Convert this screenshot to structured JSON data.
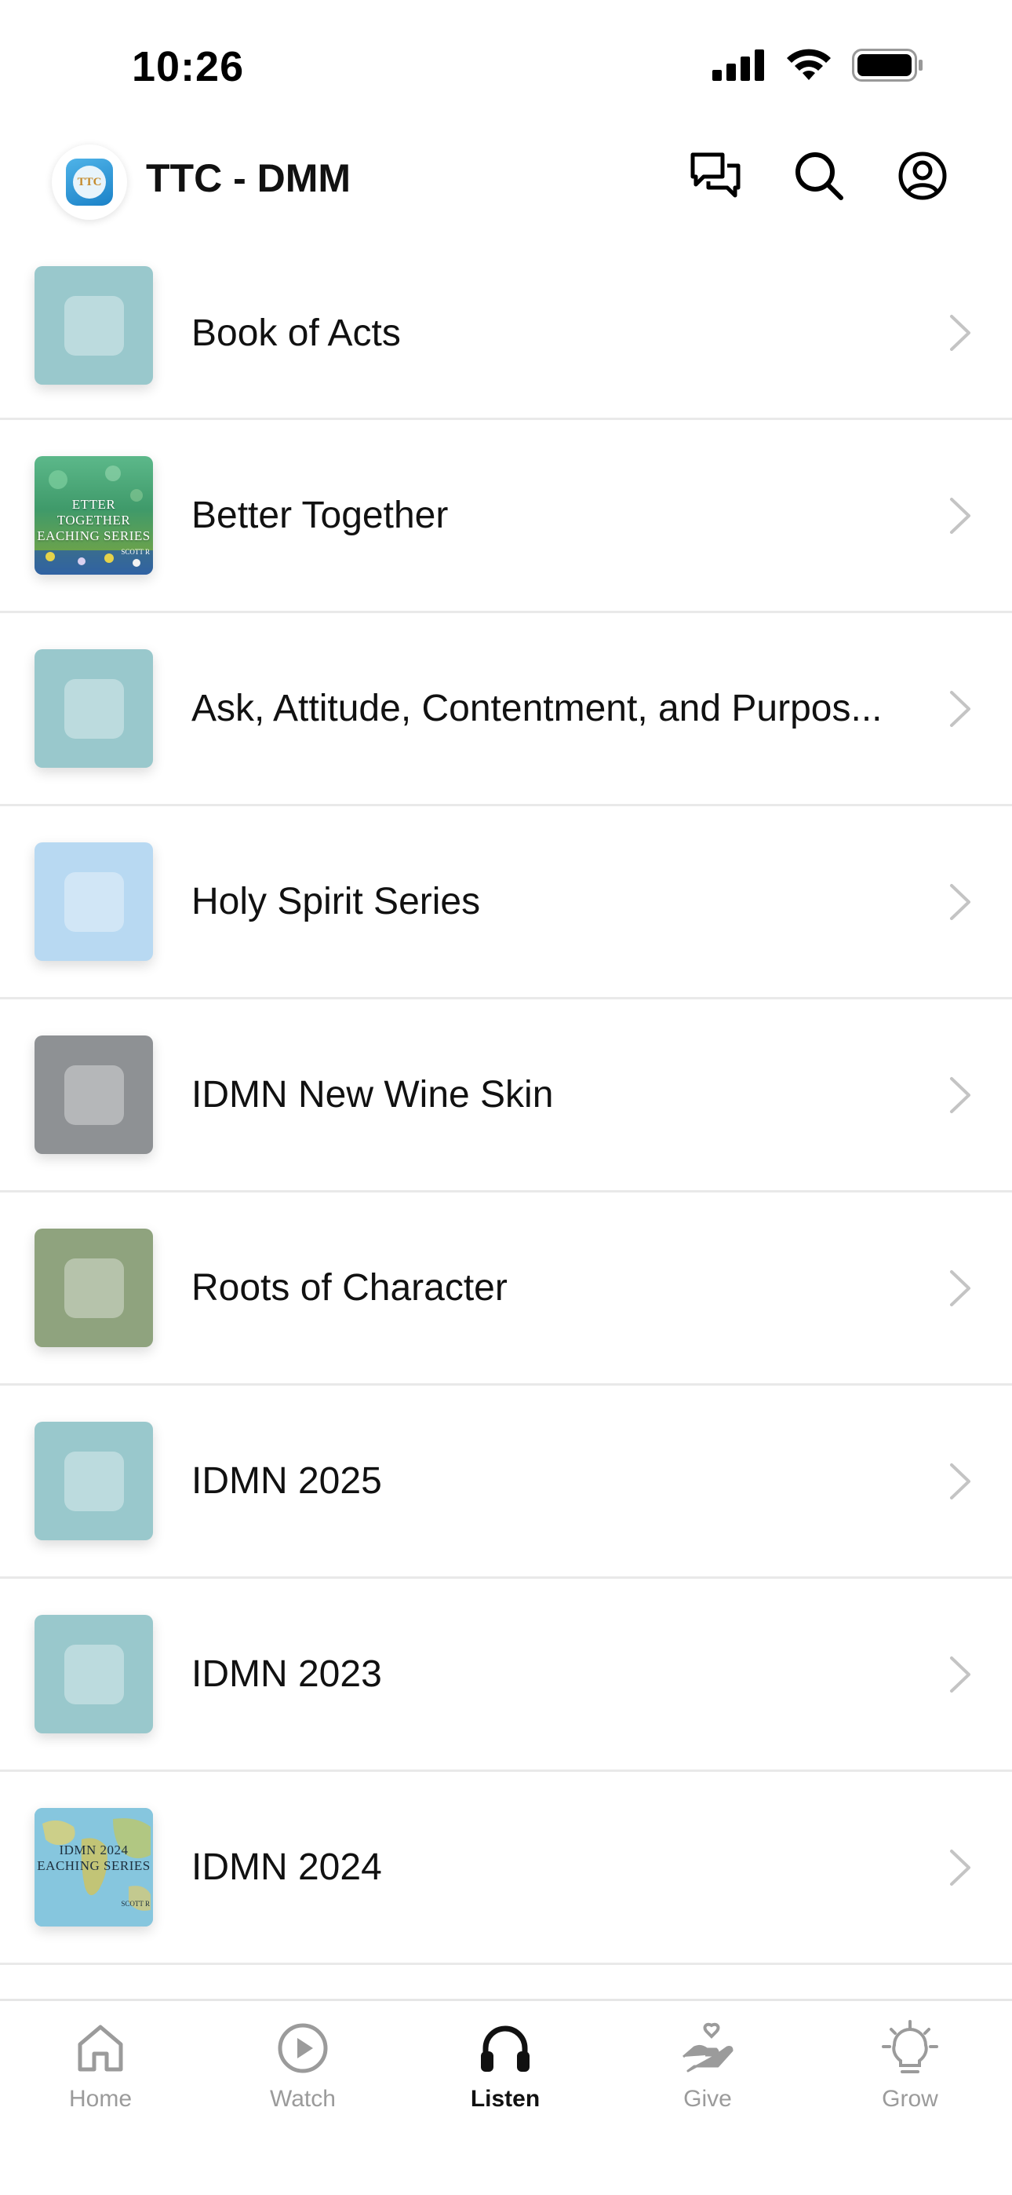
{
  "status_bar": {
    "time": "10:26"
  },
  "header": {
    "logo_text": "TTC",
    "title": "TTC - DMM",
    "icons": [
      "chat-icon",
      "search-icon",
      "account-icon"
    ]
  },
  "series": [
    {
      "title": "Book of Acts",
      "thumb_color": "#99c8cc",
      "art": ""
    },
    {
      "title": "Better Together",
      "thumb_color": "#3f9a6a",
      "art": "better-together",
      "art_lines": [
        "ETTER TOGETHER",
        "EACHING SERIES"
      ],
      "art_small": "SCOTT R"
    },
    {
      "title": "Ask, Attitude, Contentment, and Purpos...",
      "thumb_color": "#99c8cc",
      "art": ""
    },
    {
      "title": "Holy Spirit Series",
      "thumb_color": "#b8d9f2",
      "art": ""
    },
    {
      "title": "IDMN New Wine Skin",
      "thumb_color": "#8e9194",
      "art": ""
    },
    {
      "title": "Roots of Character",
      "thumb_color": "#8fa37e",
      "art": ""
    },
    {
      "title": "IDMN 2025",
      "thumb_color": "#99c8cc",
      "art": ""
    },
    {
      "title": "IDMN 2023",
      "thumb_color": "#99c8cc",
      "art": ""
    },
    {
      "title": "IDMN 2024",
      "thumb_color": "#7fc1dc",
      "art": "idmn-2024",
      "art_lines": [
        "IDMN 2024",
        "EACHING SERIES"
      ],
      "art_small": "SCOTT R"
    }
  ],
  "tabs": [
    {
      "label": "Home",
      "icon": "home-icon",
      "active": false
    },
    {
      "label": "Watch",
      "icon": "play-circle-icon",
      "active": false
    },
    {
      "label": "Listen",
      "icon": "headphones-icon",
      "active": true
    },
    {
      "label": "Give",
      "icon": "give-heart-hand-icon",
      "active": false
    },
    {
      "label": "Grow",
      "icon": "lightbulb-icon",
      "active": false
    }
  ],
  "colors": {
    "active_tab": "#111111",
    "inactive_tab": "#9b9b9b",
    "divider": "#e9e9e9",
    "chevron": "#c4c4c4"
  }
}
